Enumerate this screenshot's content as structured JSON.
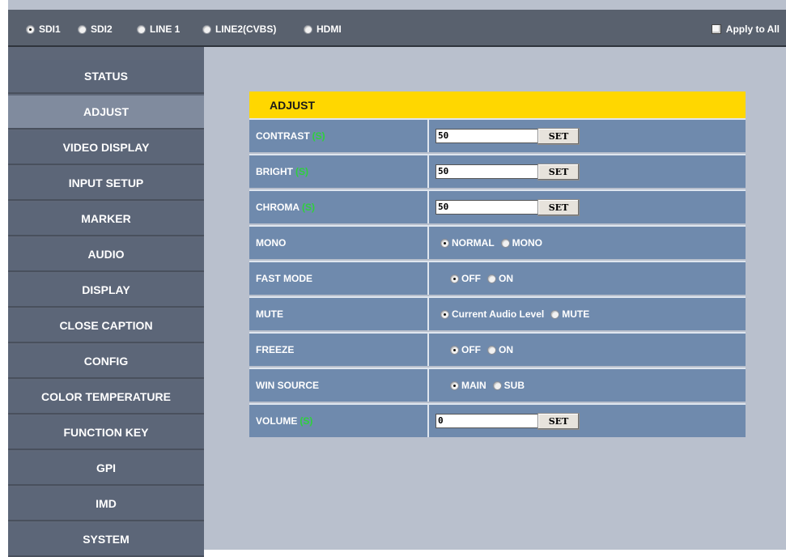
{
  "sources": [
    {
      "label": "SDI1",
      "selected": true
    },
    {
      "label": "SDI2",
      "selected": false
    },
    {
      "label": "LINE 1",
      "selected": false
    },
    {
      "label": "LINE2(CVBS)",
      "selected": false
    },
    {
      "label": "HDMI",
      "selected": false
    }
  ],
  "apply_all": {
    "label": "Apply to All",
    "checked": false
  },
  "sidebar": {
    "items": [
      {
        "label": "STATUS"
      },
      {
        "label": "ADJUST",
        "active": true
      },
      {
        "label": "VIDEO DISPLAY"
      },
      {
        "label": "INPUT SETUP"
      },
      {
        "label": "MARKER"
      },
      {
        "label": "AUDIO"
      },
      {
        "label": "DISPLAY"
      },
      {
        "label": "CLOSE CAPTION"
      },
      {
        "label": "CONFIG"
      },
      {
        "label": "COLOR TEMPERATURE"
      },
      {
        "label": "FUNCTION KEY"
      },
      {
        "label": "GPI"
      },
      {
        "label": "IMD"
      },
      {
        "label": "SYSTEM"
      }
    ]
  },
  "panel": {
    "title": "ADJUST",
    "s_marker": "(S)",
    "set_label": "SET",
    "rows": [
      {
        "label": "CONTRAST",
        "s": true,
        "value": "50"
      },
      {
        "label": "BRIGHT",
        "s": true,
        "value": "50"
      },
      {
        "label": "CHROMA",
        "s": true,
        "value": "50"
      },
      {
        "label": "MONO",
        "options": [
          "NORMAL",
          "MONO"
        ],
        "selected": 0
      },
      {
        "label": "FAST MODE",
        "options": [
          "OFF",
          "ON"
        ],
        "selected": 0
      },
      {
        "label": "MUTE",
        "options": [
          "Current Audio Level",
          "MUTE"
        ],
        "selected": 0
      },
      {
        "label": "FREEZE",
        "options": [
          "OFF",
          "ON"
        ],
        "selected": 0
      },
      {
        "label": "WIN SOURCE",
        "options": [
          "MAIN",
          "SUB"
        ],
        "selected": 0
      },
      {
        "label": "VOLUME",
        "s": true,
        "value": "0"
      }
    ]
  },
  "colors": {
    "header_yellow": "#ffd700",
    "s_green": "#2ed13b",
    "row_blue": "#6f8aad",
    "sidebar": "#5c6678"
  }
}
